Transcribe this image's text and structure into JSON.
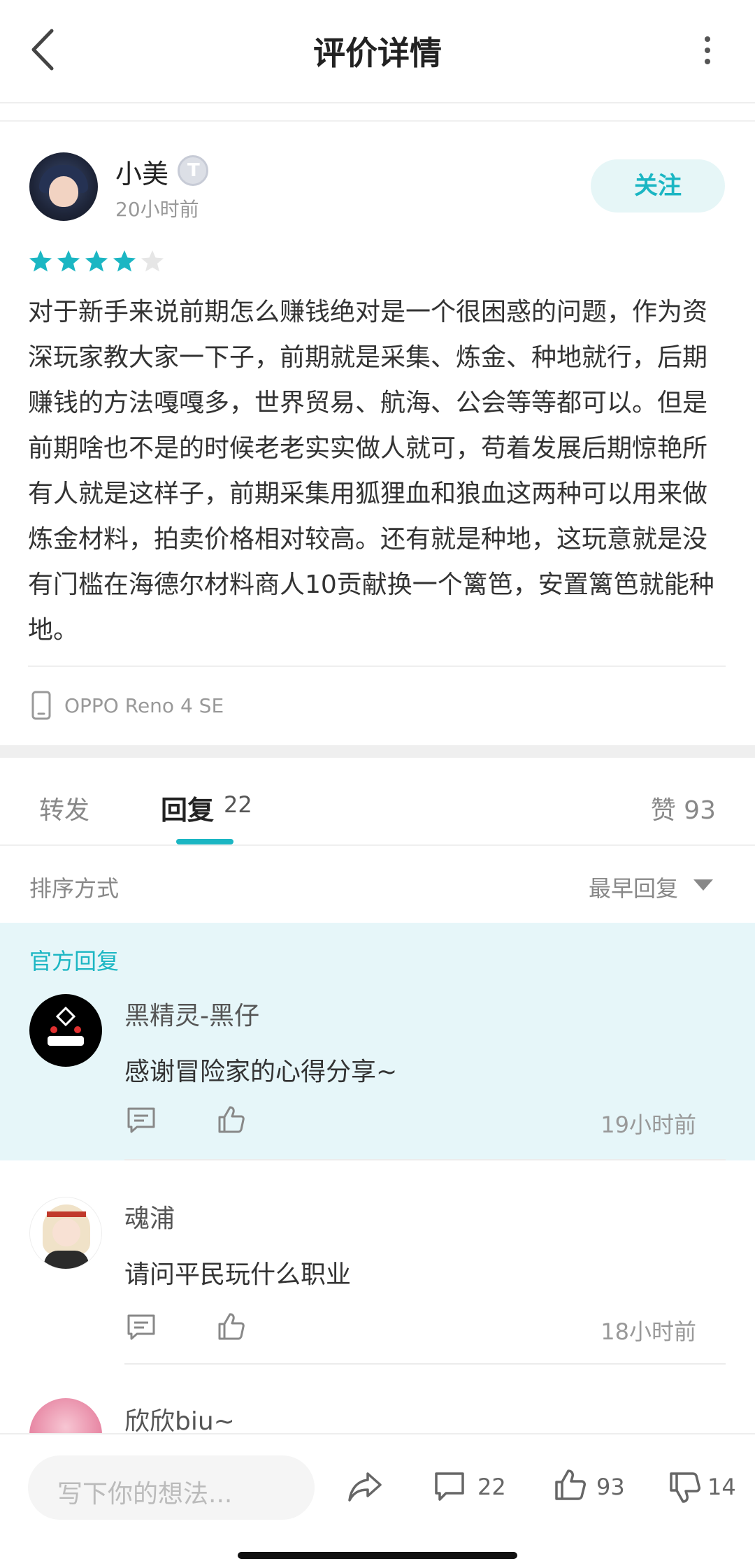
{
  "header": {
    "title": "评价详情"
  },
  "post": {
    "username": "小美",
    "level_badge": "T",
    "time": "20小时前",
    "follow_label": "关注",
    "rating": 4,
    "rating_max": 5,
    "text": "对于新手来说前期怎么赚钱绝对是一个很困惑的问题，作为资深玩家教大家一下子，前期就是采集、炼金、种地就行，后期赚钱的方法嘎嘎多，世界贸易、航海、公会等等都可以。但是前期啥也不是的时候老老实实做人就可，苟着发展后期惊艳所有人就是这样子，前期采集用狐狸血和狼血这两种可以用来做炼金材料，拍卖价格相对较高。还有就是种地，这玩意就是没有门槛在海德尔材料商人10贡献换一个篱笆，安置篱笆就能种地。",
    "device": "OPPO Reno 4 SE"
  },
  "tabs": {
    "forward_label": "转发",
    "reply_label": "回复",
    "reply_count": "22",
    "like_label": "赞 93"
  },
  "sort": {
    "label": "排序方式",
    "value": "最早回复"
  },
  "official": {
    "section_label": "官方回复",
    "name": "黑精灵-黑仔",
    "text": "感谢冒险家的心得分享~",
    "time": "19小时前"
  },
  "replies": [
    {
      "name": "魂浦",
      "text": "请问平民玩什么职业",
      "time": "18小时前"
    },
    {
      "name": "欣欣biu~"
    }
  ],
  "bottom": {
    "input_placeholder": "写下你的想法...",
    "comment_count": "22",
    "like_count": "93",
    "dislike_count": "14"
  },
  "colors": {
    "accent": "#1bb6c3",
    "official_bg": "#e6f6f9",
    "follow_bg": "#e6f6f7"
  }
}
